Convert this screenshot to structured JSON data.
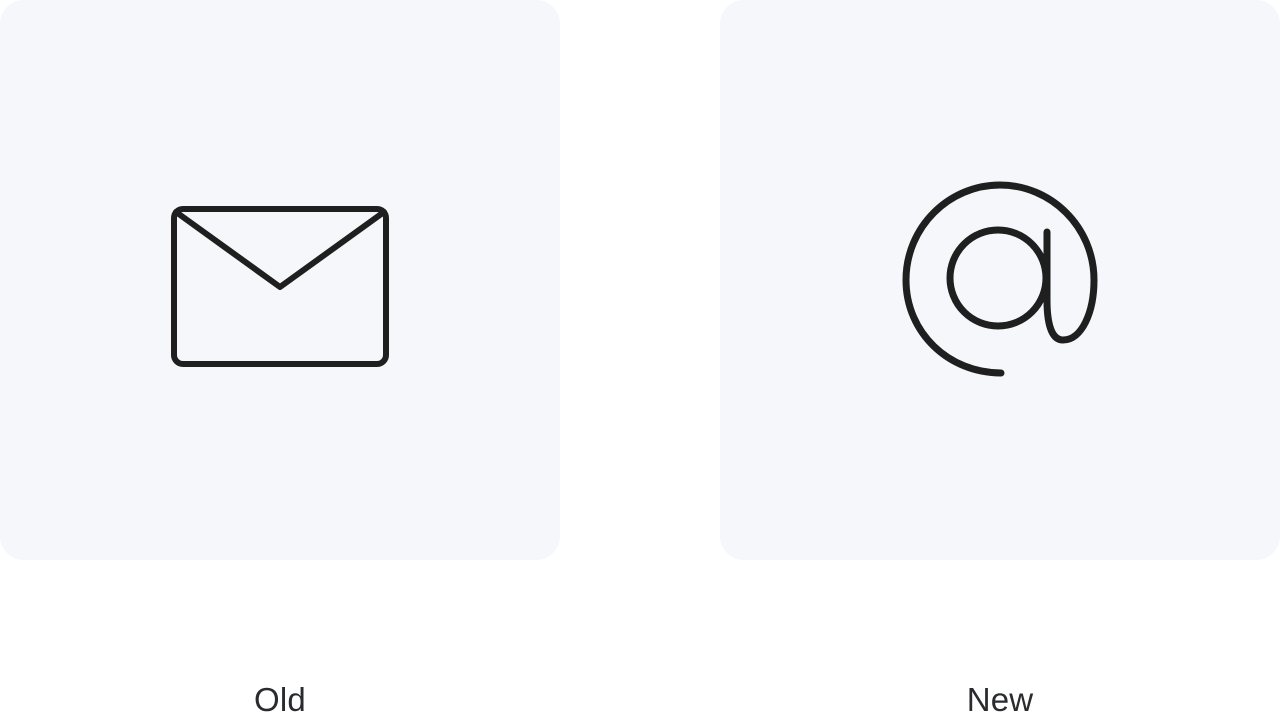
{
  "comparison": {
    "old": {
      "label": "Old",
      "icon": "envelope-icon"
    },
    "new": {
      "label": "New",
      "icon": "at-sign-icon"
    }
  },
  "colors": {
    "card_background": "#f6f7fb",
    "icon_stroke": "#1f1f1f",
    "caption_text": "#2a2b2f"
  }
}
